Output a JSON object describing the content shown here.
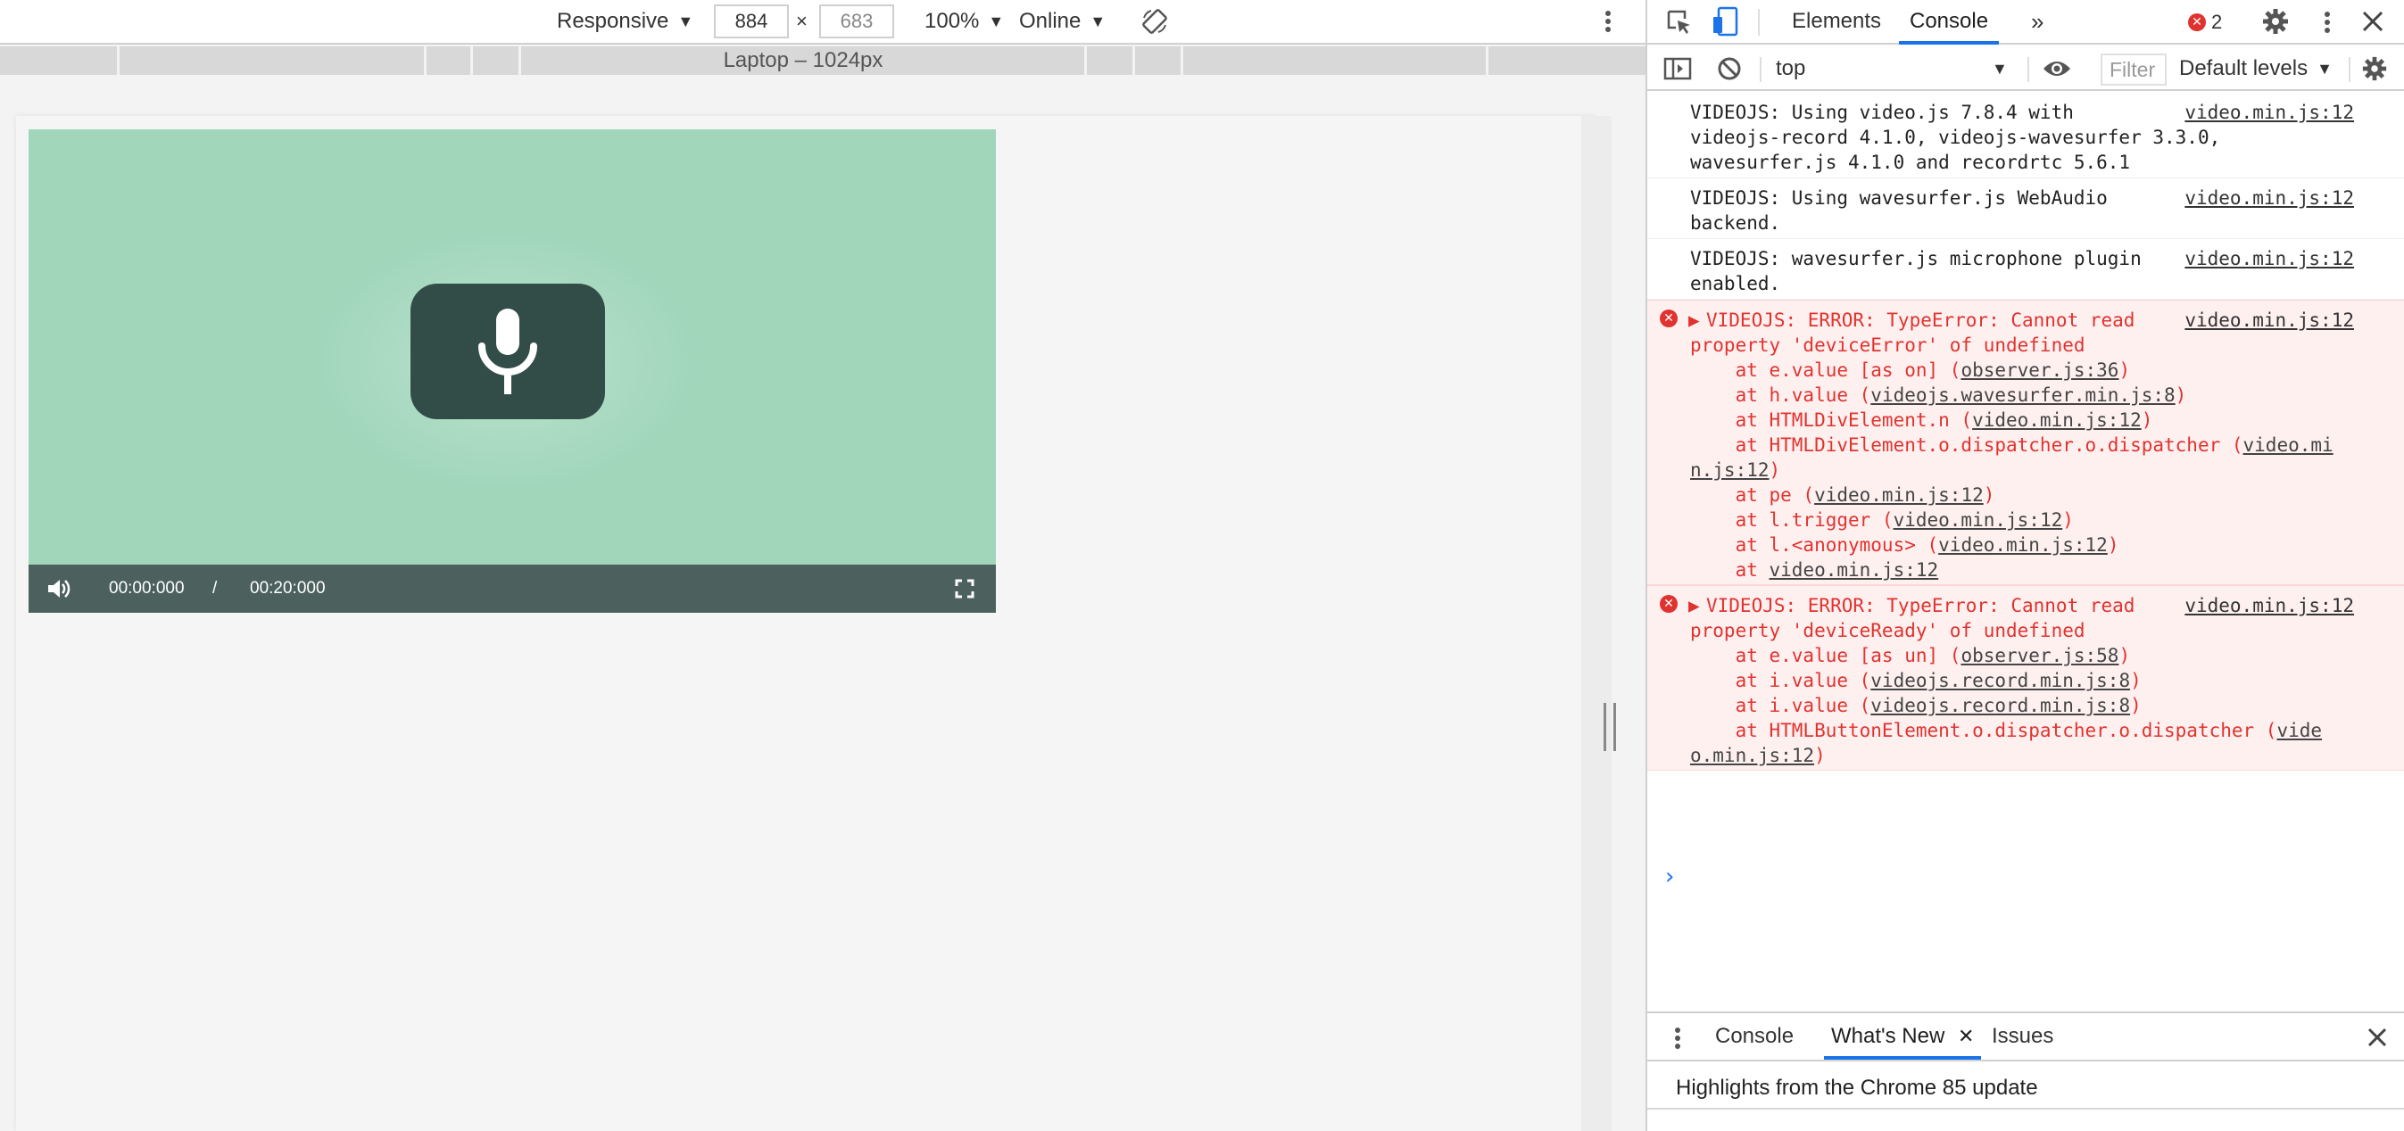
{
  "device_toolbar": {
    "device": "Responsive",
    "width": "884",
    "times": "×",
    "height": "683",
    "zoom": "100%",
    "throttle": "Online"
  },
  "media_bar": {
    "label": "Laptop – 1024px"
  },
  "player": {
    "current_time": "00:00:000",
    "separator": "/",
    "duration": "00:20:000",
    "background_color": "#a1d6bb",
    "control_bar_color": "#4c615e",
    "mic_button_color": "#324c47"
  },
  "devtools": {
    "tabs": [
      "Elements",
      "Console"
    ],
    "active_tab": "Console",
    "error_count": "2",
    "console_toolbar": {
      "context": "top",
      "filter_placeholder": "Filter",
      "levels": "Default levels"
    },
    "messages": {
      "m1": {
        "lines": [
          "VIDEOJS: Using video.js 7.8.4 with",
          "videojs-record 4.1.0, videojs-wavesurfer 3.3.0,",
          "wavesurfer.js 4.1.0 and recordrtc 5.6.1"
        ],
        "source": "video.min.js:12"
      },
      "m2": {
        "lines": [
          "VIDEOJS: Using wavesurfer.js WebAudio",
          "backend."
        ],
        "source": "video.min.js:12"
      },
      "m3": {
        "lines": [
          "VIDEOJS: wavesurfer.js microphone plugin",
          "enabled."
        ],
        "source": "video.min.js:12"
      },
      "e1": {
        "head": [
          "VIDEOJS: ERROR: TypeError: Cannot read",
          "property 'deviceError' of undefined"
        ],
        "source": "video.min.js:12",
        "stack": {
          "s1": {
            "prefix": "    at e.value [as on] (",
            "link": "observer.js:36",
            "suffix": ")"
          },
          "s2": {
            "prefix": "    at h.value (",
            "link": "videojs.wavesurfer.min.js:8",
            "suffix": ")"
          },
          "s3": {
            "prefix": "    at HTMLDivElement.n (",
            "link": "video.min.js:12",
            "suffix": ")"
          },
          "s4": {
            "prefix": "    at HTMLDivElement.o.dispatcher.o.dispatcher (",
            "link": "video.mi",
            "suffix": ""
          },
          "s4b": {
            "prefix": "",
            "link": "n.js:12",
            "suffix": ")"
          },
          "s5": {
            "prefix": "    at pe (",
            "link": "video.min.js:12",
            "suffix": ")"
          },
          "s6": {
            "prefix": "    at l.trigger (",
            "link": "video.min.js:12",
            "suffix": ")"
          },
          "s7": {
            "prefix": "    at l.<anonymous> (",
            "link": "video.min.js:12",
            "suffix": ")"
          },
          "s8": {
            "prefix": "    at ",
            "link": "video.min.js:12",
            "suffix": ""
          }
        }
      },
      "e2": {
        "head": [
          "VIDEOJS: ERROR: TypeError: Cannot read",
          "property 'deviceReady' of undefined"
        ],
        "source": "video.min.js:12",
        "stack": {
          "s1": {
            "prefix": "    at e.value [as un] (",
            "link": "observer.js:58",
            "suffix": ")"
          },
          "s2": {
            "prefix": "    at i.value (",
            "link": "videojs.record.min.js:8",
            "suffix": ")"
          },
          "s3": {
            "prefix": "    at i.value (",
            "link": "videojs.record.min.js:8",
            "suffix": ")"
          },
          "s4": {
            "prefix": "    at HTMLButtonElement.o.dispatcher.o.dispatcher (",
            "link": "vide",
            "suffix": ""
          },
          "s4b": {
            "prefix": "",
            "link": "o.min.js:12",
            "suffix": ")"
          }
        }
      }
    },
    "drawer": {
      "tabs": [
        "Console",
        "What's New",
        "Issues"
      ],
      "active_tab": "What's New",
      "highlights": "Highlights from the Chrome 85 update"
    },
    "accent_color": "#1a73e8",
    "error_color": "#e0332f"
  }
}
